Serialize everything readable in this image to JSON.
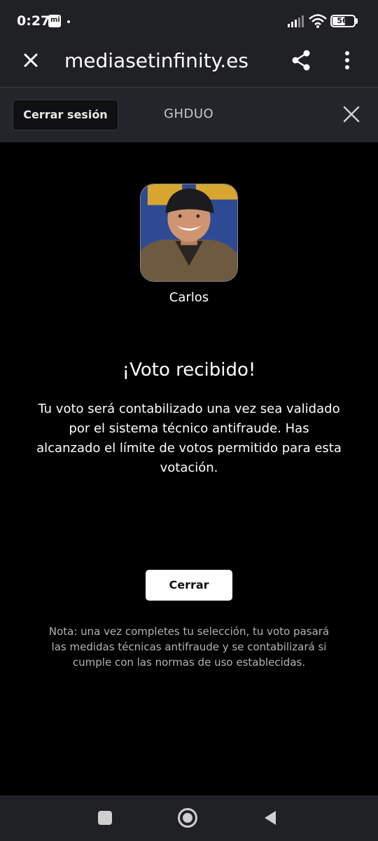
{
  "status_bar": {
    "time": "0:27",
    "battery": "56",
    "icons": [
      "mi-icon",
      "signal-icon",
      "wifi-icon",
      "battery-icon"
    ]
  },
  "browser": {
    "url": "mediasetinfinity.es",
    "icons": [
      "close-icon",
      "share-icon",
      "more-vert-icon"
    ]
  },
  "site_header": {
    "logout_label": "Cerrar sesión",
    "username": "GHDUO"
  },
  "vote": {
    "candidate_name": "Carlos",
    "title": "¡Voto recibido!",
    "message": "Tu voto será contabilizado una vez sea validado por el sistema técnico antifraude. Has alcanzado el límite de votos permitido para esta votación.",
    "close_label": "Cerrar",
    "note": "Nota: una vez completes tu selección, tu voto pasará las medidas técnicas antifraude y se contabilizará si cumple con las normas de uso establecidas."
  },
  "nav_bar": {
    "icons": [
      "recents-icon",
      "home-icon",
      "back-icon"
    ]
  },
  "colors": {
    "background": "#000000",
    "chrome": "#202124",
    "header": "#22252a",
    "note_text": "#b4b4b4",
    "button_bg": "#ffffff"
  }
}
